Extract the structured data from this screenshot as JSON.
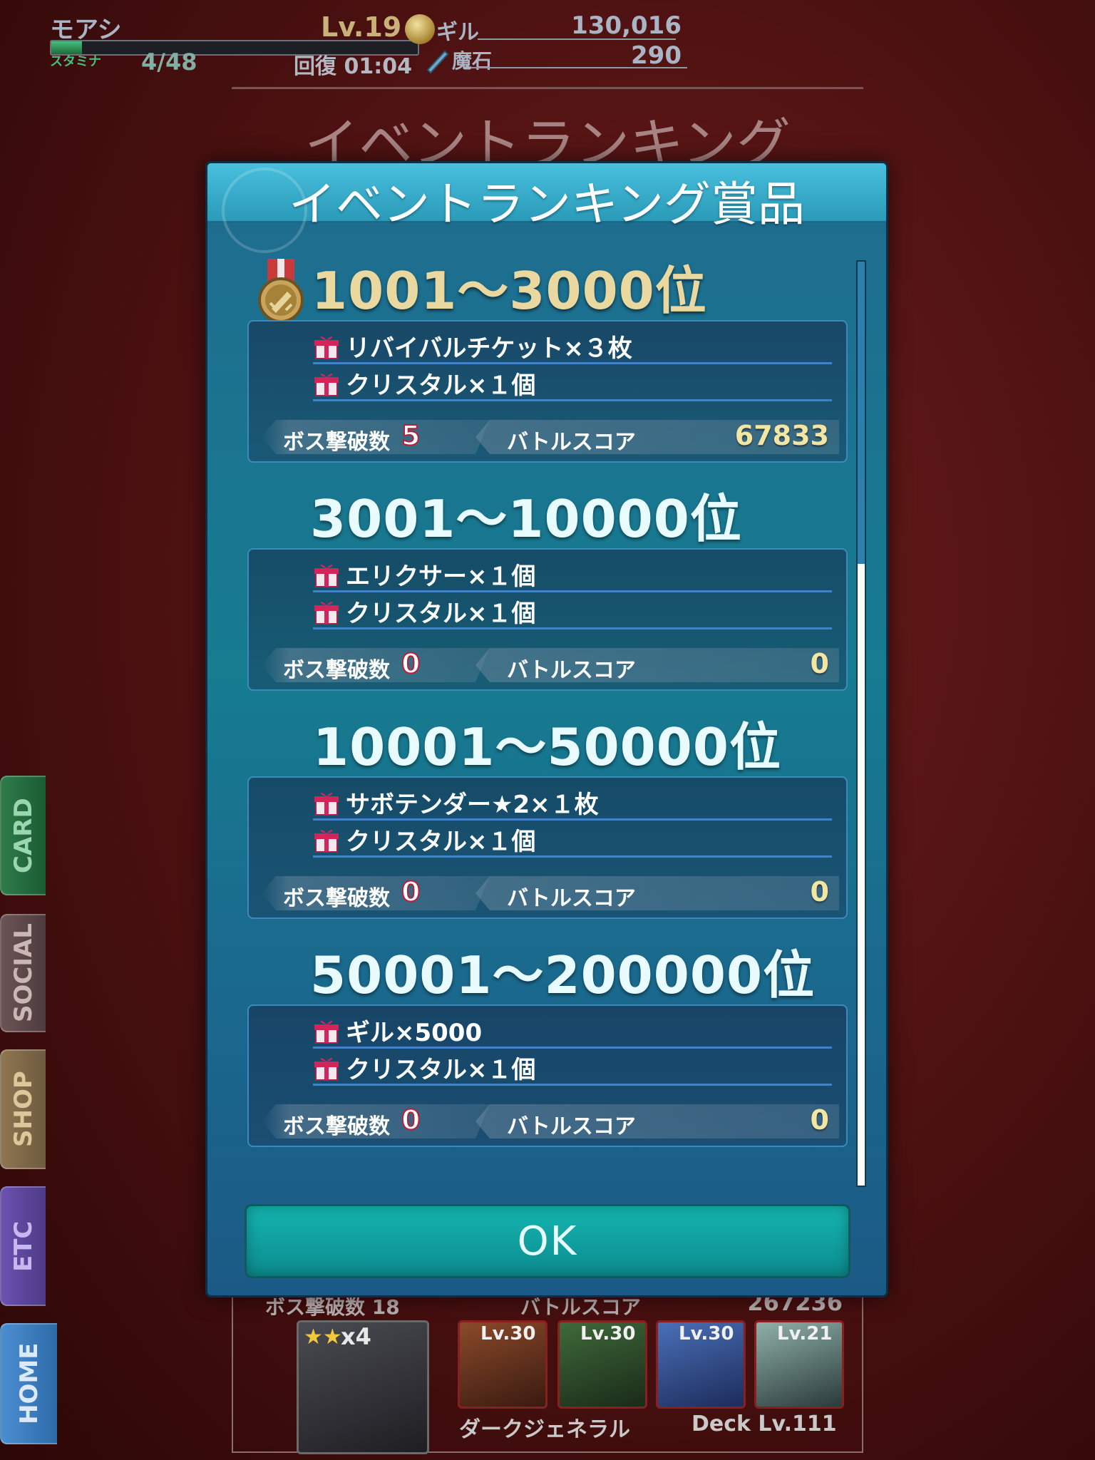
{
  "status": {
    "player_name": "モアシ",
    "stamina_label": "スタミナ",
    "stamina": "4/48",
    "stamina_fraction": 0.083,
    "level": "Lv.19",
    "recover": "回復 01:04",
    "gil_label": "ギル",
    "gil": "130,016",
    "magic_stone_label": "魔石",
    "magic_stone": "290"
  },
  "page_title": "イベントランキング",
  "side_tabs": {
    "card": "CARD",
    "social": "SOCIAL",
    "shop": "SHOP",
    "etc": "ETC",
    "home": "HOME"
  },
  "background_panel": {
    "boss_label": "ボス撃破数 18",
    "score_label": "バトルスコア",
    "score": "267236",
    "leader_multiplier": "x4",
    "party_levels": [
      "Lv.30",
      "Lv.30",
      "Lv.30",
      "Lv.21"
    ],
    "deck_name": "ダークジェネラル",
    "deck_level": "Deck Lv.111"
  },
  "modal": {
    "title": "イベントランキング賞品",
    "ok_label": "OK",
    "boss_label": "ボス撃破数",
    "score_label": "バトルスコア",
    "tiers": [
      {
        "range": "1001〜3000位",
        "prizes": [
          "リバイバルチケット×３枚",
          "クリスタル×１個"
        ],
        "boss_count": "5",
        "battle_score": "67833"
      },
      {
        "range": "3001〜10000位",
        "prizes": [
          "エリクサー×１個",
          "クリスタル×１個"
        ],
        "boss_count": "0",
        "battle_score": "0"
      },
      {
        "range": "10001〜50000位",
        "prizes": [
          "サボテンダー★2×１枚",
          "クリスタル×１個"
        ],
        "boss_count": "0",
        "battle_score": "0"
      },
      {
        "range": "50001〜200000位",
        "prizes": [
          "ギル×5000",
          "クリスタル×１個"
        ],
        "boss_count": "0",
        "battle_score": "0"
      }
    ]
  },
  "colors": {
    "accent_gold": "#e9d8a0",
    "boss_count_outline": "#b8203a",
    "modal_header": "#48c0de",
    "ok_button": "#14b5b0"
  }
}
